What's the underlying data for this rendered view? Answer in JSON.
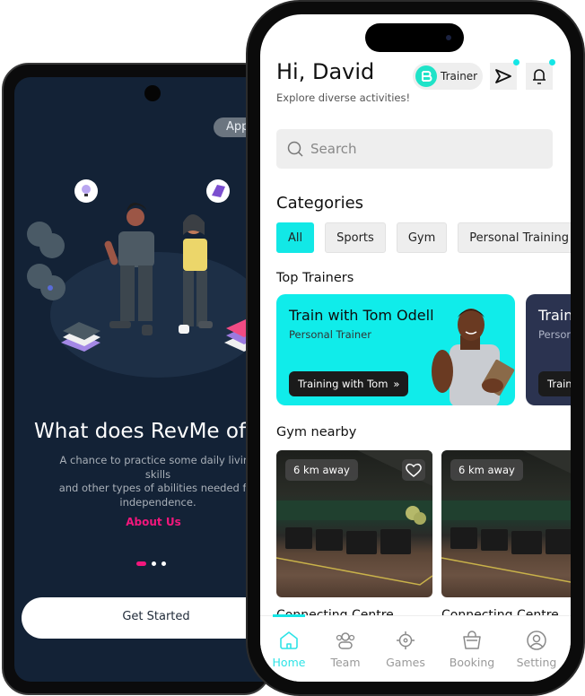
{
  "android": {
    "app_tour_label": "App Tour",
    "title": "What does RevMe offer?",
    "description": "A chance to practice some daily living skills\nand other types of abilities needed for\nindependence.",
    "about_link": "About Us",
    "pager": {
      "count": 3,
      "active_index": 0
    },
    "get_started_label": "Get Started",
    "colors": {
      "background": "#132236",
      "accent": "#f2177c"
    }
  },
  "iphone": {
    "header": {
      "greeting": "Hi, David",
      "subtitle": "Explore diverse activities!",
      "role_badge": "Trainer",
      "send_icon": "send-icon",
      "bell_icon": "bell-icon",
      "has_notifications": true
    },
    "search": {
      "placeholder": "Search",
      "value": ""
    },
    "categories": {
      "title": "Categories",
      "items": [
        {
          "label": "All",
          "active": true
        },
        {
          "label": "Sports",
          "active": false
        },
        {
          "label": "Gym",
          "active": false
        },
        {
          "label": "Personal Training",
          "active": false
        }
      ]
    },
    "top_trainers": {
      "title": "Top Trainers",
      "cards": [
        {
          "name": "Train with Tom Odell",
          "role": "Personal Trainer",
          "cta": "Training with Tom",
          "color": "#10ecea"
        },
        {
          "name": "Train with",
          "role": "Personal Trainer",
          "cta": "Training with",
          "color": "#2b3350"
        }
      ]
    },
    "gym_nearby": {
      "title": "Gym nearby",
      "items": [
        {
          "distance": "6 km away",
          "name": "Connecting Centre",
          "favorite_icon": "heart-icon"
        },
        {
          "distance": "6 km away",
          "name": "Connecting Centre"
        }
      ]
    },
    "bottom_nav": {
      "items": [
        {
          "label": "Home",
          "icon": "home-icon",
          "active": true
        },
        {
          "label": "Team",
          "icon": "team-icon",
          "active": false
        },
        {
          "label": "Games",
          "icon": "target-icon",
          "active": false
        },
        {
          "label": "Booking",
          "icon": "bag-icon",
          "active": false
        },
        {
          "label": "Setting",
          "icon": "profile-icon",
          "active": false
        }
      ]
    },
    "colors": {
      "accent": "#14e6e6",
      "chip_bg": "#eeeeee"
    }
  }
}
